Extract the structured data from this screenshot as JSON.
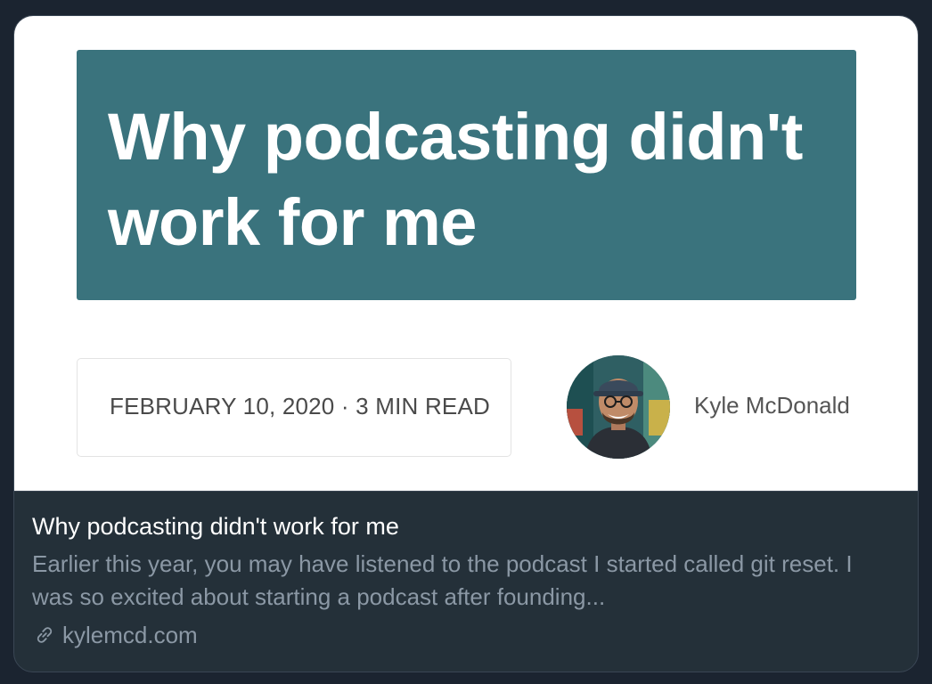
{
  "preview": {
    "hero_title": "Why podcasting didn't work for me",
    "date_read": "FEBRUARY 10, 2020 · 3 MIN READ",
    "author": "Kyle McDonald"
  },
  "card": {
    "title": "Why podcasting didn't work for me",
    "description": "Earlier this year, you may have listened to the podcast I started called git reset. I was so excited about starting a podcast after founding...",
    "domain": "kylemcd.com",
    "domain_icon": "link-icon"
  },
  "colors": {
    "page_bg": "#1b2430",
    "card_bg": "#243039",
    "hero_bg": "#3a737d",
    "muted_text": "#8b98a5"
  }
}
